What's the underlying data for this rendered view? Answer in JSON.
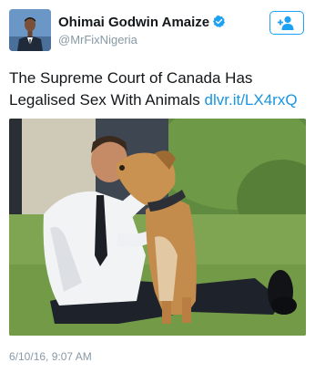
{
  "tweet": {
    "author": {
      "display_name": "Ohimai Godwin Amaize",
      "handle": "@MrFixNigeria",
      "verified": true,
      "avatar_icon": "profile-photo"
    },
    "follow_icon": "follow-person-plus-icon",
    "text": "The Supreme Court of Canada Has Legalised Sex With Animals",
    "link": "dlvr.it/LX4rxQ",
    "media_description": "photo",
    "timestamp": "6/10/16, 9:07 AM"
  },
  "colors": {
    "accent": "#1da1f2",
    "link": "#1b95e0",
    "secondary_text": "#8899a6",
    "primary_text": "#14171a"
  }
}
